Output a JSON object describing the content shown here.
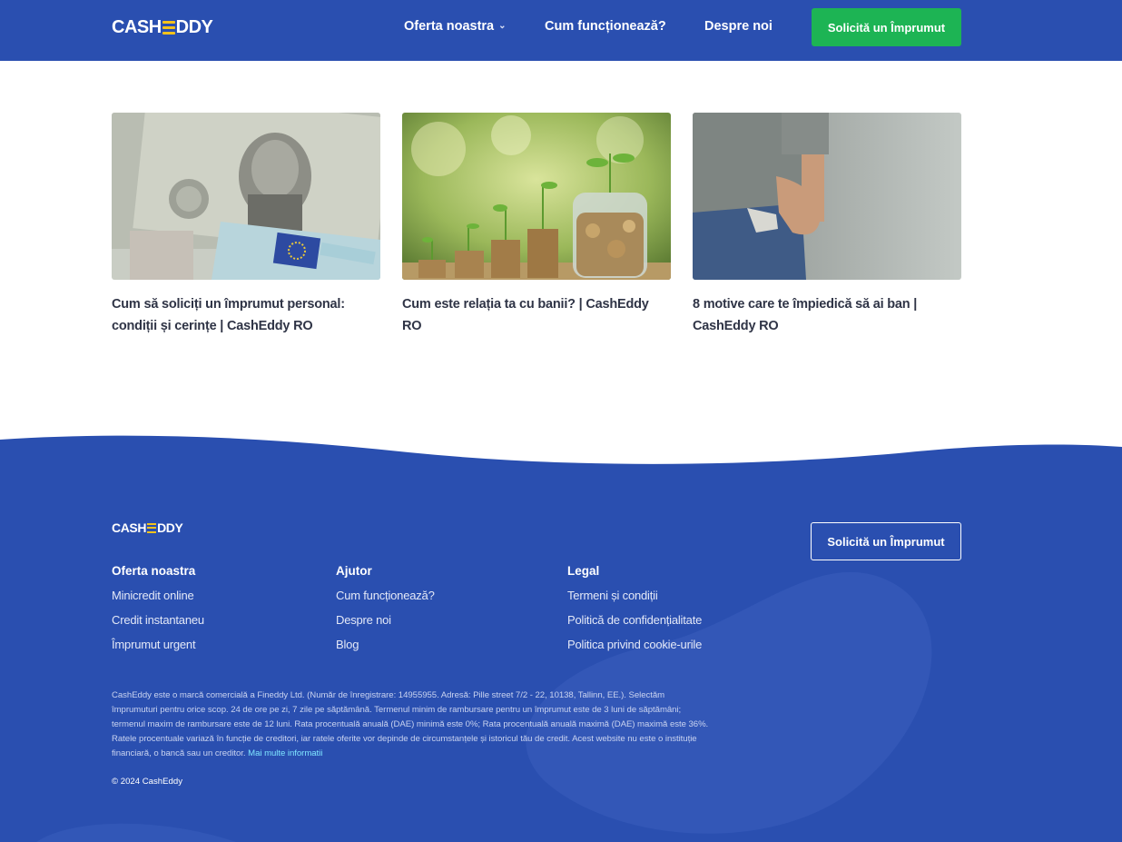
{
  "header": {
    "logo": {
      "left": "CASH",
      "right": "DDY"
    },
    "nav": [
      {
        "label": "Oferta noastra",
        "has_dropdown": true
      },
      {
        "label": "Cum funcționează?"
      },
      {
        "label": "Despre noi"
      }
    ],
    "cta": "Solicită un Împrumut"
  },
  "articles": [
    {
      "title": "Cum să soliciți un împrumut personal: condiții și cerințe | CashEddy RO",
      "image": "banknotes-image"
    },
    {
      "title": "Cum este relația ta cu banii? | CashEddy RO",
      "image": "coins-plants-image"
    },
    {
      "title": "8 motive care te împiedică să ai ban | CashEddy RO",
      "image": "empty-pocket-image"
    }
  ],
  "footer": {
    "logo": {
      "left": "CASH",
      "right": "DDY"
    },
    "cta": "Solicită un Împrumut",
    "columns": [
      {
        "heading": "Oferta noastra",
        "links": [
          "Minicredit online",
          "Credit instantaneu",
          "Împrumut urgent"
        ]
      },
      {
        "heading": "Ajutor",
        "links": [
          "Cum funcționează?",
          "Despre noi",
          "Blog"
        ]
      },
      {
        "heading": "Legal",
        "links": [
          "Termeni și condiții",
          "Politică de confidențialitate",
          "Politica privind cookie-urile"
        ]
      }
    ],
    "disclaimer": "CashEddy este o marcă comercială a Fineddy Ltd. (Număr de înregistrare: 14955955. Adresă: Pille street 7/2 - 22, 10138, Tallinn, EE.). Selectăm împrumuturi pentru orice scop. 24 de ore pe zi, 7 zile pe săptămână. Termenul minim de rambursare pentru un împrumut este de 3 luni de săptămâni; termenul maxim de rambursare este de 12 luni. Rata procentuală anuală (DAE) minimă este 0%; Rata procentuală anuală maximă (DAE) maximă este 36%. Ratele procentuale variază în funcție de creditori, iar ratele oferite vor depinde de circumstanțele și istoricul tău de credit. Acest website nu este o instituție financiară, o bancă sau un creditor.",
    "more_link": "Mai multe informatii",
    "copyright": "© 2024 CashEddy"
  },
  "colors": {
    "brand_blue": "#2a4fb0",
    "cta_green": "#1db454",
    "logo_accent": "#f4c21b",
    "title_text": "#2f3446"
  }
}
